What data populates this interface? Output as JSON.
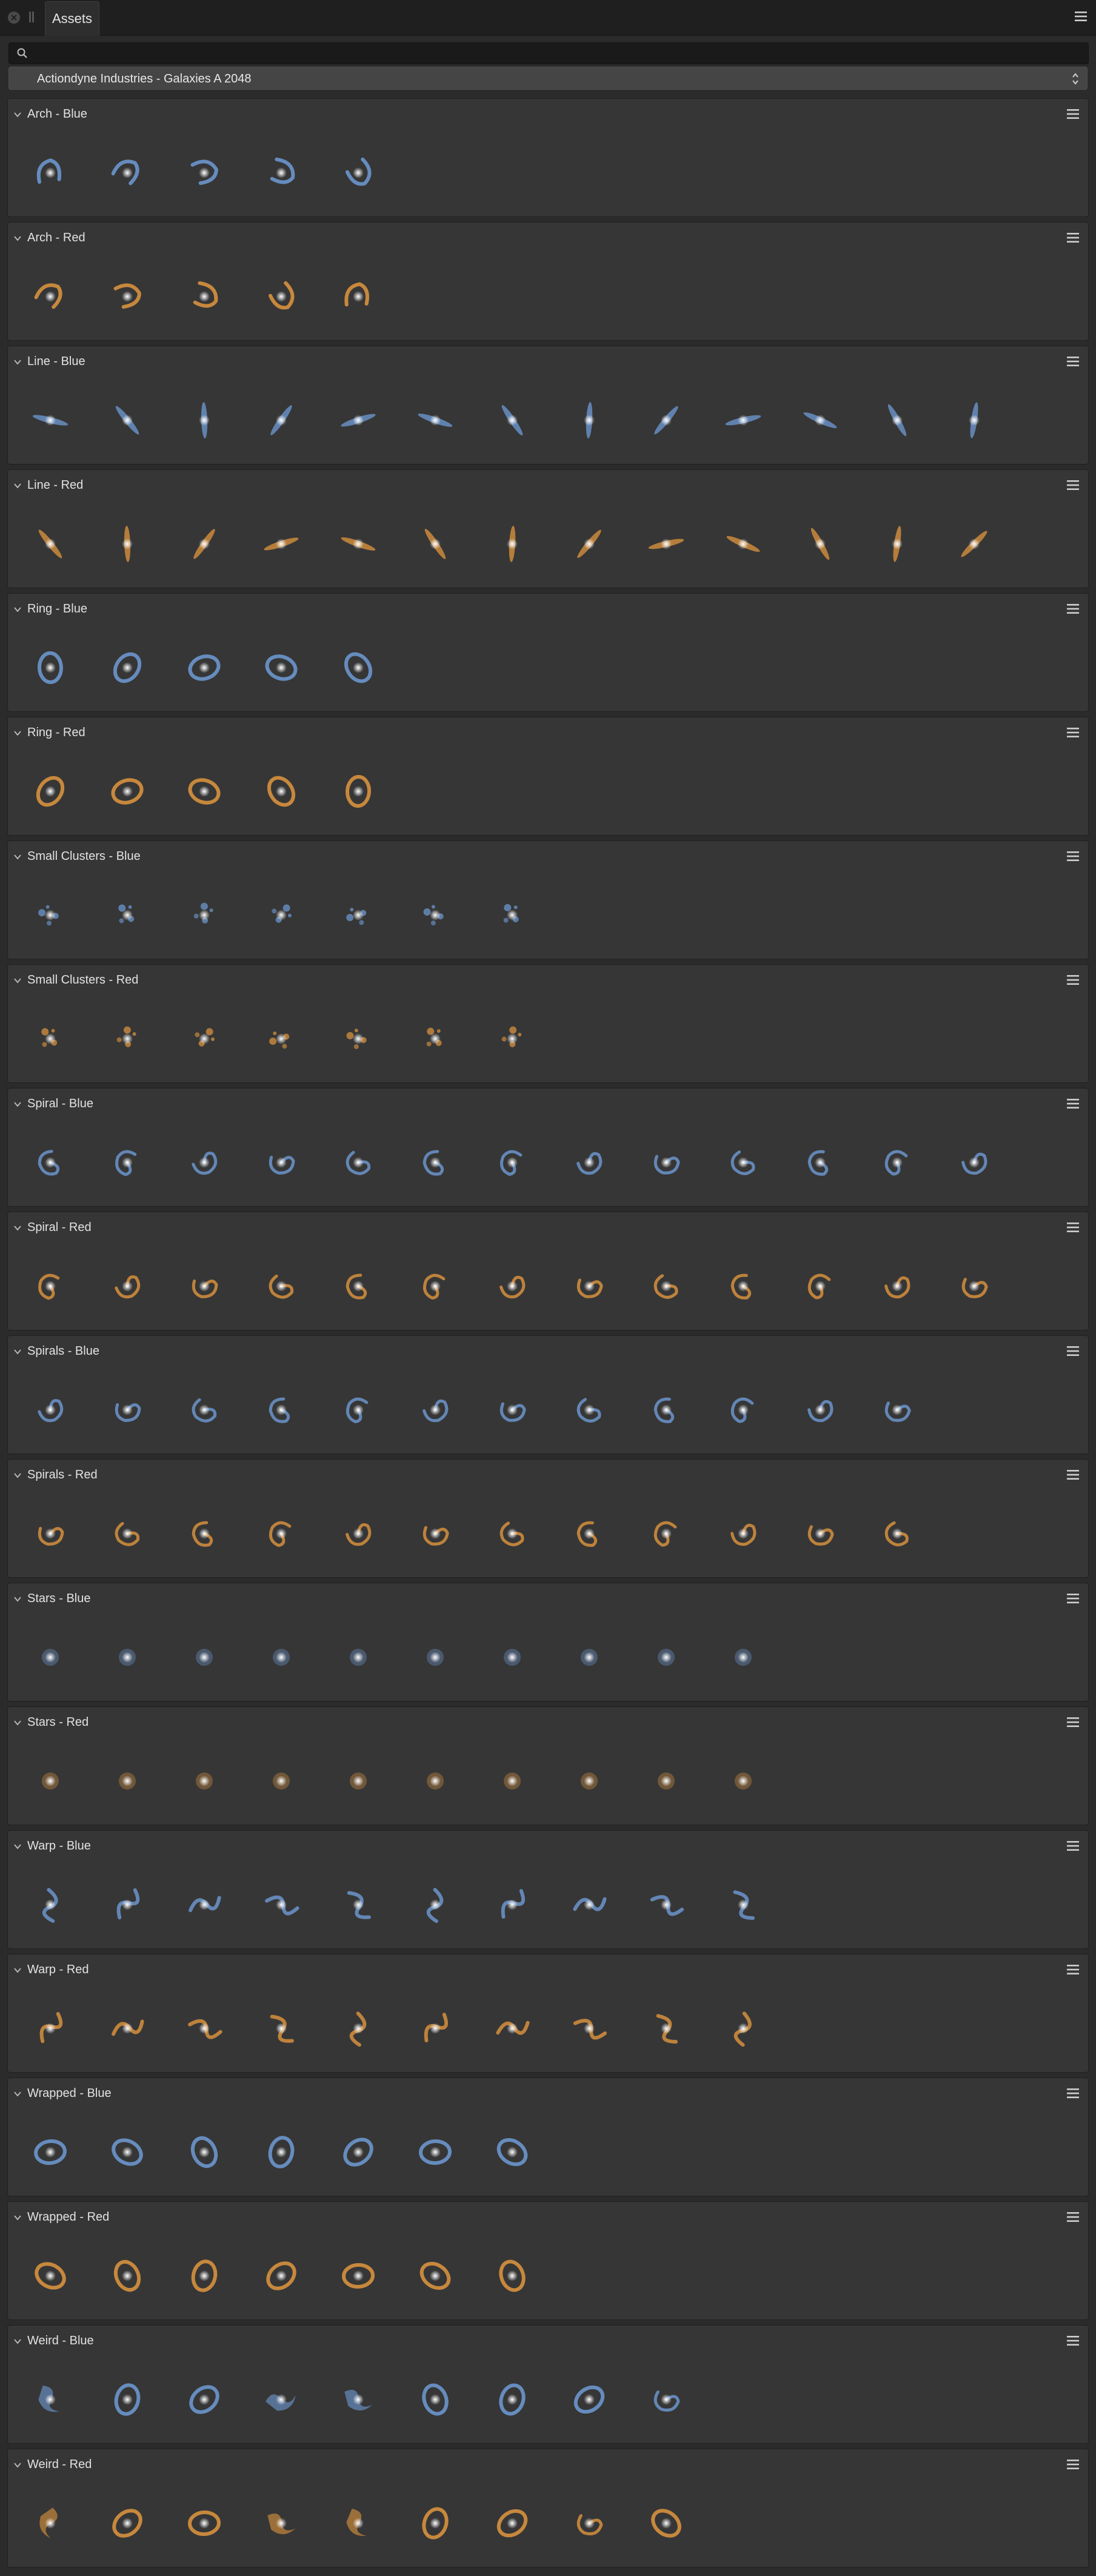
{
  "window": {
    "tab_label": "Assets"
  },
  "search": {
    "value": "",
    "placeholder": ""
  },
  "category_select": {
    "selected": "Actiondyne Industries - Galaxies A 2048"
  },
  "colors": {
    "blue": "#6f9bd6",
    "red": "#e0963e",
    "panel": "#363636",
    "background": "#2b2b2b"
  },
  "sections": [
    {
      "title": "Arch - Blue",
      "tone": "blue",
      "count": 5,
      "shapes": [
        "arc",
        "arc",
        "arc",
        "arc",
        "arc"
      ]
    },
    {
      "title": "Arch - Red",
      "tone": "red",
      "count": 5,
      "shapes": [
        "arc",
        "arc",
        "arc",
        "arc",
        "arc"
      ]
    },
    {
      "title": "Line - Blue",
      "tone": "blue",
      "count": 13,
      "shapes": [
        "line",
        "line",
        "line",
        "line",
        "line",
        "line",
        "line",
        "line",
        "line",
        "line",
        "line",
        "line",
        "line"
      ]
    },
    {
      "title": "Line - Red",
      "tone": "red",
      "count": 13,
      "shapes": [
        "line",
        "line",
        "line",
        "line",
        "line",
        "line",
        "line",
        "line",
        "line",
        "line",
        "line",
        "line",
        "line"
      ]
    },
    {
      "title": "Ring - Blue",
      "tone": "blue",
      "count": 5,
      "shapes": [
        "ring",
        "ring",
        "ring",
        "ring",
        "ring"
      ]
    },
    {
      "title": "Ring - Red",
      "tone": "red",
      "count": 5,
      "shapes": [
        "ring",
        "ring",
        "ring",
        "ring",
        "ring"
      ]
    },
    {
      "title": "Small Clusters - Blue",
      "tone": "blue",
      "count": 7,
      "shapes": [
        "cluster",
        "cluster",
        "cluster",
        "cluster",
        "cluster",
        "cluster",
        "cluster"
      ]
    },
    {
      "title": "Small Clusters - Red",
      "tone": "red",
      "count": 7,
      "shapes": [
        "cluster",
        "cluster",
        "cluster",
        "cluster",
        "cluster",
        "cluster",
        "cluster"
      ]
    },
    {
      "title": "Spiral - Blue",
      "tone": "blue",
      "count": 13,
      "shapes": [
        "spiral",
        "spiral",
        "spiral",
        "spiral",
        "spiral",
        "spiral",
        "spiral",
        "spiral",
        "spiral",
        "spiral",
        "spiral",
        "spiral",
        "spiral"
      ]
    },
    {
      "title": "Spiral - Red",
      "tone": "red",
      "count": 13,
      "shapes": [
        "spiral",
        "spiral",
        "spiral",
        "spiral",
        "spiral",
        "spiral",
        "spiral",
        "spiral",
        "spiral",
        "spiral",
        "spiral",
        "spiral",
        "spiral"
      ]
    },
    {
      "title": "Spirals - Blue",
      "tone": "blue",
      "count": 12,
      "shapes": [
        "spiral",
        "spiral",
        "spiral",
        "spiral",
        "spiral",
        "spiral",
        "spiral",
        "spiral",
        "spiral",
        "spiral",
        "spiral",
        "spiral"
      ]
    },
    {
      "title": "Spirals - Red",
      "tone": "red",
      "count": 12,
      "shapes": [
        "spiral",
        "spiral",
        "spiral",
        "spiral",
        "spiral",
        "spiral",
        "spiral",
        "spiral",
        "spiral",
        "spiral",
        "spiral",
        "spiral"
      ]
    },
    {
      "title": "Stars - Blue",
      "tone": "blue",
      "count": 10,
      "shapes": [
        "star",
        "star",
        "star",
        "star",
        "star",
        "star",
        "star",
        "star",
        "star",
        "star"
      ]
    },
    {
      "title": "Stars - Red",
      "tone": "red",
      "count": 10,
      "shapes": [
        "star",
        "star",
        "star",
        "star",
        "star",
        "star",
        "star",
        "star",
        "star",
        "star"
      ]
    },
    {
      "title": "Warp - Blue",
      "tone": "blue",
      "count": 10,
      "shapes": [
        "warp",
        "warp",
        "warp",
        "warp",
        "warp",
        "warp",
        "warp",
        "warp",
        "warp",
        "warp"
      ]
    },
    {
      "title": "Warp - Red",
      "tone": "red",
      "count": 10,
      "shapes": [
        "warp",
        "warp",
        "warp",
        "warp",
        "warp",
        "warp",
        "warp",
        "warp",
        "warp",
        "warp"
      ]
    },
    {
      "title": "Wrapped - Blue",
      "tone": "blue",
      "count": 7,
      "shapes": [
        "ring",
        "ring",
        "ring",
        "ring",
        "ring",
        "ring",
        "ring"
      ]
    },
    {
      "title": "Wrapped - Red",
      "tone": "red",
      "count": 7,
      "shapes": [
        "ring",
        "ring",
        "ring",
        "ring",
        "ring",
        "ring",
        "ring"
      ]
    },
    {
      "title": "Weird - Blue",
      "tone": "blue",
      "count": 9,
      "shapes": [
        "weird",
        "ring",
        "ring",
        "weird",
        "weird",
        "ring",
        "ring",
        "ring",
        "spiral"
      ]
    },
    {
      "title": "Weird - Red",
      "tone": "red",
      "count": 9,
      "shapes": [
        "weird",
        "ring",
        "ring",
        "weird",
        "weird",
        "ring",
        "ring",
        "spiral",
        "ring"
      ]
    }
  ]
}
